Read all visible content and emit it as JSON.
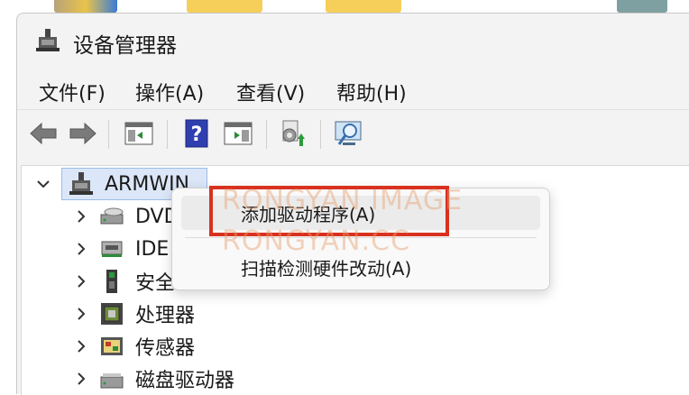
{
  "window": {
    "title": "设备管理器"
  },
  "menu": [
    "文件(F)",
    "操作(A)",
    "查看(V)",
    "帮助(H)"
  ],
  "toolbar": {
    "buttons": [
      "back-icon",
      "forward-icon",
      "properties-pane-icon",
      "help-icon",
      "show-pane-icon",
      "update-driver-icon",
      "scan-hardware-icon"
    ]
  },
  "tree": {
    "root": "ARMWIN",
    "children": [
      {
        "label": "DVD",
        "icon": "dvd-drive-icon"
      },
      {
        "label": "IDE",
        "icon": "ide-controller-icon"
      },
      {
        "label": "安全",
        "icon": "security-device-icon"
      },
      {
        "label": "处理器",
        "icon": "processor-icon"
      },
      {
        "label": "传感器",
        "icon": "sensor-icon"
      },
      {
        "label": "磁盘驱动器",
        "icon": "disk-drive-icon"
      }
    ]
  },
  "context_menu": {
    "items": [
      "添加驱动程序(A)",
      "扫描检测硬件改动(A)"
    ]
  },
  "watermark": [
    "RONGYAN IMAGE",
    "RONGYAN.CC"
  ],
  "colors": {
    "highlight_box": "#d9311f",
    "selection": "#dbe7f8"
  }
}
